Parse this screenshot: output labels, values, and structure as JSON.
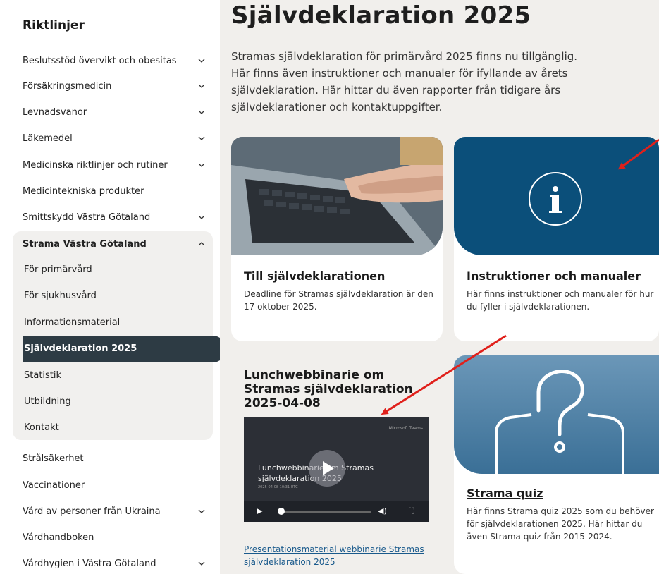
{
  "sidebar": {
    "title": "Riktlinjer",
    "items": [
      {
        "label": "Beslutsstöd övervikt och obesitas"
      },
      {
        "label": "Försäkringsmedicin"
      },
      {
        "label": "Levnadsvanor"
      },
      {
        "label": "Läkemedel"
      },
      {
        "label": "Medicinska riktlinjer och rutiner"
      },
      {
        "label": "Medicintekniska produkter"
      },
      {
        "label": "Smittskydd Västra Götaland"
      },
      {
        "label": "Strama Västra Götaland"
      },
      {
        "label": "För primärvård"
      },
      {
        "label": "För sjukhusvård"
      },
      {
        "label": "Informationsmaterial"
      },
      {
        "label": "Självdeklaration 2025"
      },
      {
        "label": "Statistik"
      },
      {
        "label": "Utbildning"
      },
      {
        "label": "Kontakt"
      },
      {
        "label": "Strålsäkerhet"
      },
      {
        "label": "Vaccinationer"
      },
      {
        "label": "Vård av personer från Ukraina"
      },
      {
        "label": "Vårdhandboken"
      },
      {
        "label": "Vårdhygien i Västra Götaland"
      }
    ]
  },
  "main": {
    "title": "Självdeklaration 2025",
    "intro": "Stramas självdeklaration för primärvård 2025 finns nu tillgänglig. Här finns även instruktioner och manualer för ifyllande av årets självdeklaration. Här hittar du även rapporter från tidigare års självdeklarationer och kontaktuppgifter.",
    "cards": [
      {
        "link": "Till självdeklarationen",
        "desc": "Deadline för Stramas självdeklaration är den 17 oktober 2025."
      },
      {
        "link": "Instruktioner och manualer",
        "desc": "Här finns instruktioner och manualer för hur du fyller i självdeklarationen."
      },
      {
        "title": "Lunchwebbinarie om Stramas självdeklaration 2025-04-08",
        "link": "Presentationsmaterial webbinarie Stramas självdeklaration 2025"
      },
      {
        "link": "Strama quiz",
        "desc": "Här finns Strama quiz 2025 som du behöver för självdeklarationen 2025. Här hittar du även Strama quiz från 2015-2024."
      }
    ],
    "video": {
      "brand": "Microsoft Teams",
      "title": "Lunchwebbinarie om Stramas självdeklaration 2025",
      "date": "2025-04-08 10:31 UTC"
    }
  },
  "colors": {
    "active_bg": "#2d3b44",
    "info_blue": "#0b4f7a",
    "arrow_red": "#e0201b",
    "page_bg": "#f1efec"
  }
}
